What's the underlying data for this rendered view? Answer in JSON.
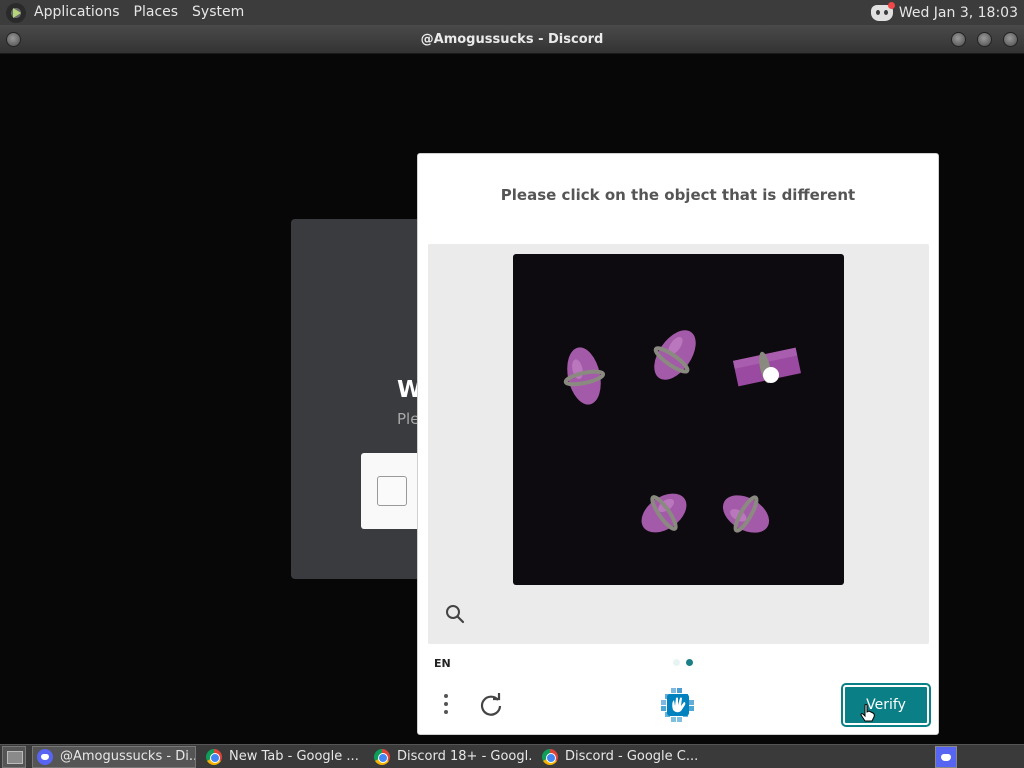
{
  "top_panel": {
    "menus": [
      "Applications",
      "Places",
      "System"
    ],
    "clock": "Wed Jan  3, 18:03",
    "tray_icon": "discord-icon"
  },
  "window": {
    "title": "@Amogussucks - Discord"
  },
  "discord_card": {
    "heading_partial": "W",
    "sub_partial": "Ple"
  },
  "captcha": {
    "prompt": "Please click on the object that is different",
    "language": "EN",
    "verify_label": "Verify",
    "progress": {
      "total": 2,
      "current": 2
    },
    "icons": {
      "zoom": "magnifier-icon",
      "menu": "vertical-dots-icon",
      "refresh": "refresh-icon",
      "logo": "hcaptcha-logo-icon"
    },
    "colors": {
      "accent": "#0b7f86",
      "object": "#a35aa8"
    }
  },
  "taskbar": {
    "tasks": [
      {
        "label": "@Amogussucks - Di...",
        "icon": "discord-icon",
        "active": true
      },
      {
        "label": "New Tab - Google ...",
        "icon": "chrome-icon",
        "active": false
      },
      {
        "label": "Discord 18+ - Googl...",
        "icon": "chrome-icon",
        "active": false
      },
      {
        "label": "Discord - Google C...",
        "icon": "chrome-icon",
        "active": false
      }
    ]
  }
}
